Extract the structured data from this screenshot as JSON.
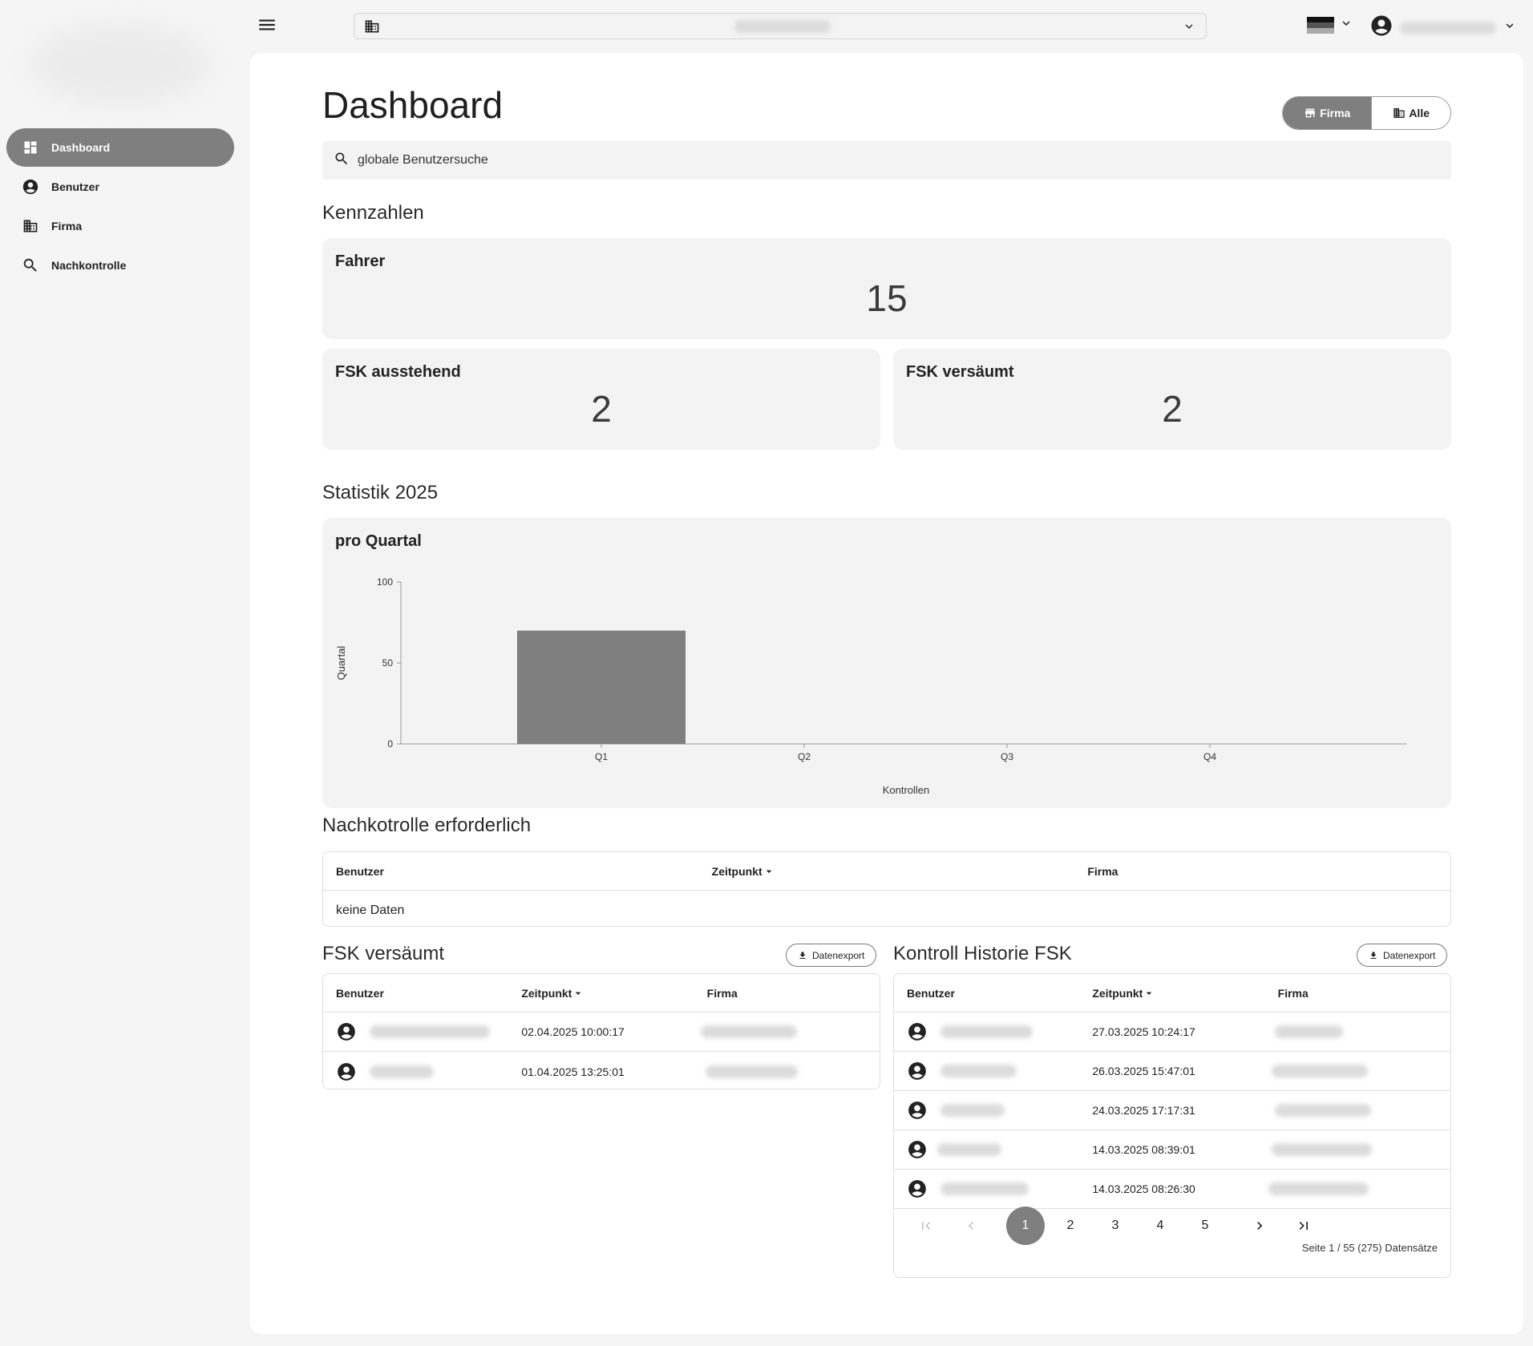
{
  "sidebar": {
    "items": [
      {
        "label": "Dashboard",
        "icon": "dashboard-icon",
        "active": true
      },
      {
        "label": "Benutzer",
        "icon": "account-circle-icon",
        "active": false
      },
      {
        "label": "Firma",
        "icon": "domain-icon",
        "active": false
      },
      {
        "label": "Nachkontrolle",
        "icon": "search-icon",
        "active": false
      }
    ]
  },
  "topbar": {
    "menu_icon": "menu-icon",
    "tenant_icon": "domain-icon",
    "language_icon": "flag-icon",
    "account_icon": "account-circle-icon"
  },
  "header": {
    "title": "Dashboard",
    "toggle": {
      "firma": "Firma",
      "alle": "Alle",
      "selected": "Firma"
    }
  },
  "search": {
    "placeholder": "globale Benutzersuche"
  },
  "kennzahlen": {
    "title": "Kennzahlen",
    "fahrer": {
      "label": "Fahrer",
      "value": "15"
    },
    "fsk_ausstehend": {
      "label": "FSK ausstehend",
      "value": "2"
    },
    "fsk_versaeumt": {
      "label": "FSK versäumt",
      "value": "2"
    }
  },
  "statistik": {
    "title": "Statistik 2025",
    "card_title": "pro Quartal"
  },
  "chart_data": {
    "type": "bar",
    "title": "pro Quartal",
    "categories": [
      "Q1",
      "Q2",
      "Q3",
      "Q4"
    ],
    "values": [
      70,
      0,
      0,
      0
    ],
    "xlabel": "Kontrollen",
    "ylabel": "Quartal",
    "ylim": [
      0,
      100
    ],
    "yticks": [
      0,
      50,
      100
    ],
    "grid": false,
    "bar_color": "#7f7f7f"
  },
  "nachkontrolle": {
    "title": "Nachkotrolle erforderlich",
    "columns": [
      "Benutzer",
      "Zeitpunkt",
      "Firma"
    ],
    "empty_text": "keine Daten"
  },
  "fsk_versaeumt_table": {
    "title": "FSK versäumt",
    "export_label": "Datenexport",
    "columns": [
      "Benutzer",
      "Zeitpunkt",
      "Firma"
    ],
    "rows": [
      {
        "zeitpunkt": "02.04.2025 10:00:17"
      },
      {
        "zeitpunkt": "01.04.2025 13:25:01"
      }
    ]
  },
  "historie_table": {
    "title": "Kontroll Historie FSK",
    "export_label": "Datenexport",
    "columns": [
      "Benutzer",
      "Zeitpunkt",
      "Firma"
    ],
    "rows": [
      {
        "zeitpunkt": "27.03.2025 10:24:17"
      },
      {
        "zeitpunkt": "26.03.2025 15:47:01"
      },
      {
        "zeitpunkt": "24.03.2025 17:17:31"
      },
      {
        "zeitpunkt": "14.03.2025 08:39:01"
      },
      {
        "zeitpunkt": "14.03.2025 08:26:30"
      }
    ],
    "pagination": {
      "pages": [
        "1",
        "2",
        "3",
        "4",
        "5"
      ],
      "current": "1",
      "info": "Seite 1 / 55 (275) Datensätze"
    }
  },
  "colors": {
    "accent": "#7f7f7f",
    "surface": "#f3f3f3",
    "background": "#f5f5f5"
  }
}
